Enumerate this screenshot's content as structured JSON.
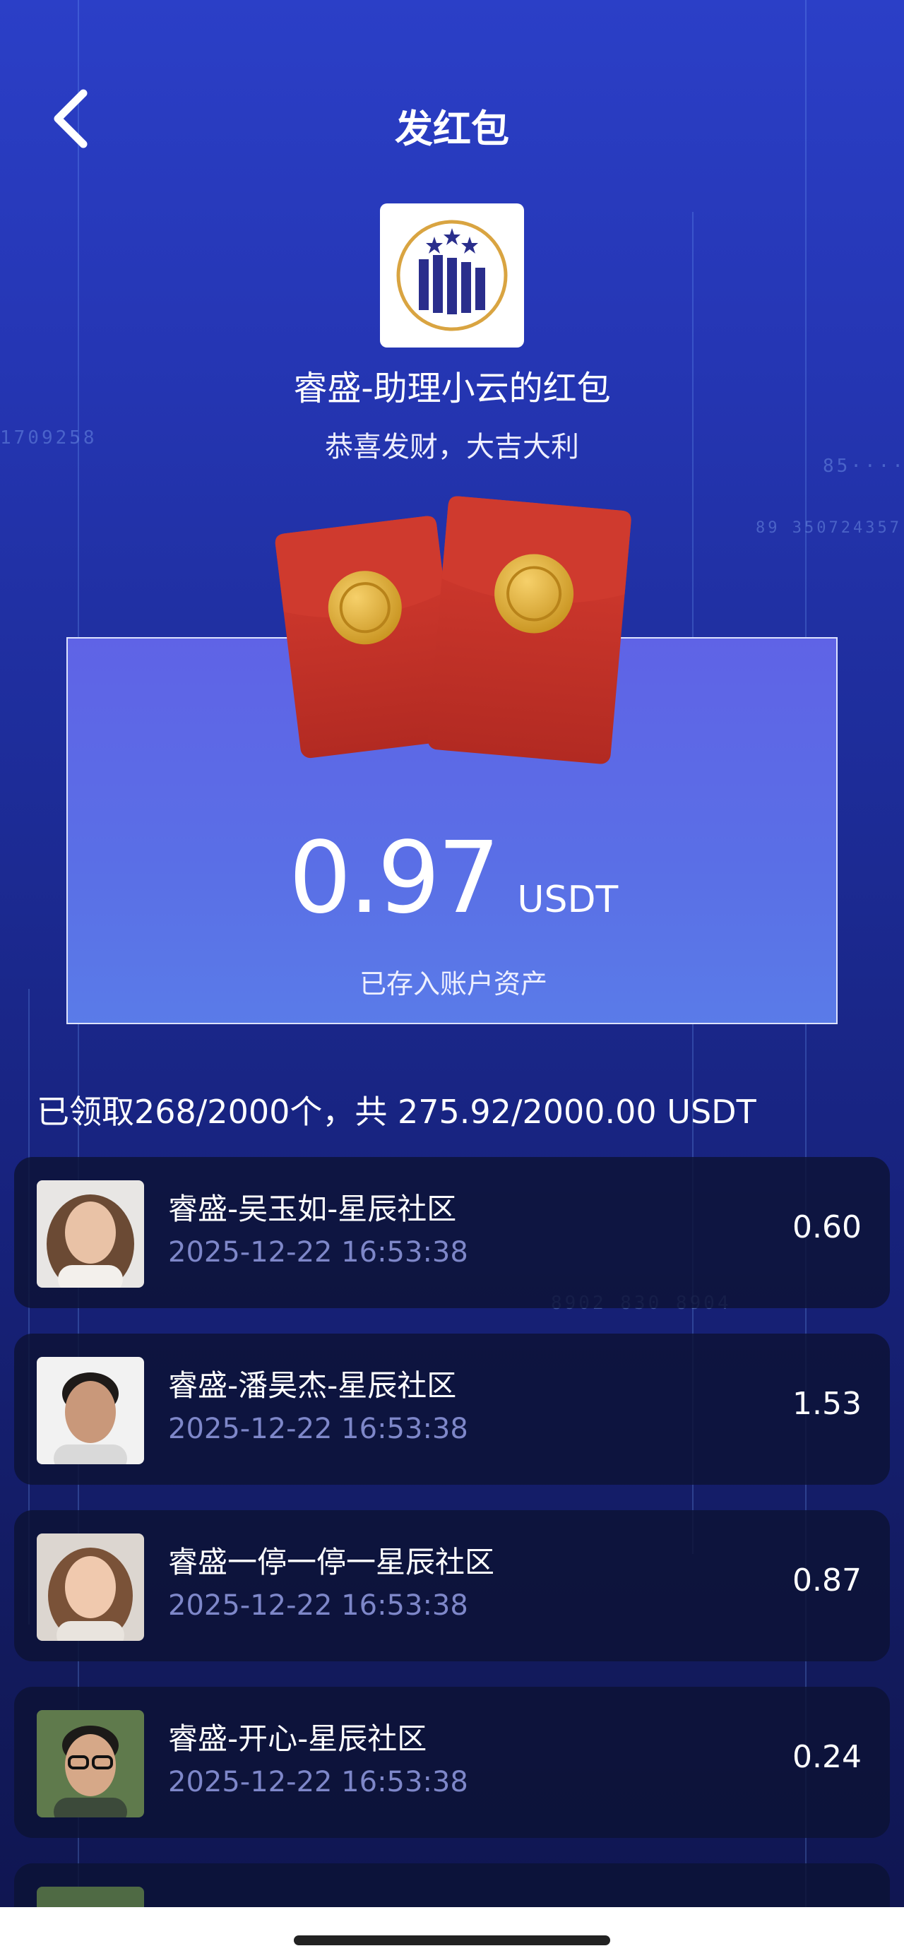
{
  "header": {
    "title": "发红包",
    "back_icon": "chevron-left-icon"
  },
  "sender": {
    "logo_icon": "company-logo",
    "name": "睿盛-助理小云的红包",
    "greeting": "恭喜发财，大吉大利"
  },
  "amount_card": {
    "illustration": "red-envelope-icon",
    "amount": "0.97",
    "unit": "USDT",
    "note": "已存入账户资产"
  },
  "summary": "已领取268/2000个，共 275.92/2000.00 USDT",
  "records": [
    {
      "name": "睿盛-吴玉如-星辰社区",
      "time": "2025-12-22 16:53:38",
      "amount": "0.60",
      "avatar": "avatar-woman-1"
    },
    {
      "name": "睿盛-潘昊杰-星辰社区",
      "time": "2025-12-22 16:53:38",
      "amount": "1.53",
      "avatar": "avatar-man-1"
    },
    {
      "name": "睿盛一停一停一星辰社区",
      "time": "2025-12-22 16:53:38",
      "amount": "0.87",
      "avatar": "avatar-woman-2"
    },
    {
      "name": "睿盛-开心-星辰社区",
      "time": "2025-12-22 16:53:38",
      "amount": "0.24",
      "avatar": "avatar-man-2"
    }
  ],
  "colors": {
    "accent": "#5a6fe6",
    "envelope_red": "#c8352c",
    "coin_gold": "#e3b23c",
    "row_bg": "#0c1234"
  }
}
